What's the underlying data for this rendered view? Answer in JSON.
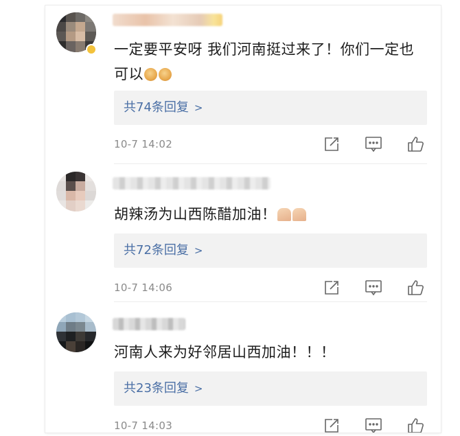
{
  "comments": [
    {
      "text": "一定要平安呀 我们河南挺过来了！你们一定也可以",
      "emojis": [
        "fist-icon",
        "fist-icon"
      ],
      "replies_label": "共74条回复",
      "replies_chevron": ">",
      "time": "10-7 14:02",
      "verified_badge": true
    },
    {
      "text": "胡辣汤为山西陈醋加油！",
      "emojis": [
        "pray-icon",
        "pray-icon"
      ],
      "replies_label": "共72条回复",
      "replies_chevron": ">",
      "time": "10-7 14:06",
      "verified_badge": false
    },
    {
      "text": "河南人来为好邻居山西加油！！！",
      "emojis": [],
      "replies_label": "共23条回复",
      "replies_chevron": ">",
      "time": "10-7 14:03",
      "verified_badge": false
    }
  ],
  "action_icons": [
    "share-icon",
    "comment-icon",
    "like-icon"
  ],
  "colors": {
    "reply_link": "#4a6fa5",
    "reply_bg": "#f2f2f2",
    "meta_text": "#8a8a8a",
    "badge": "#f3c23c"
  }
}
